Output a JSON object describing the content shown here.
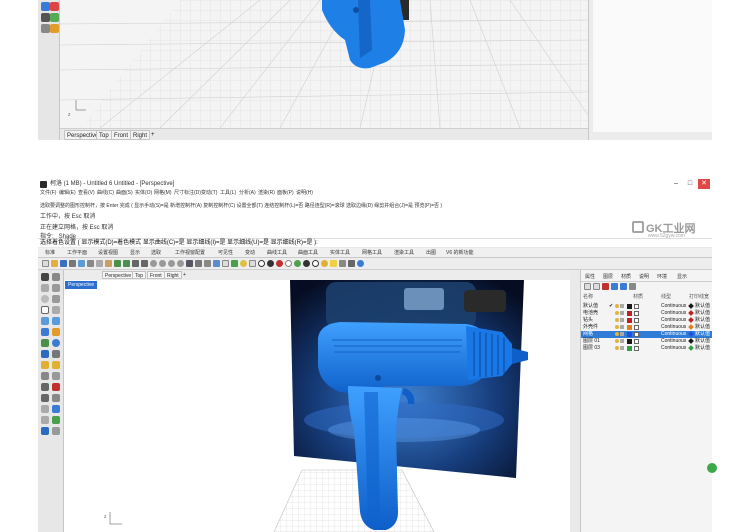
{
  "top_frame": {
    "view_tabs": [
      "Perspective",
      "Top",
      "Front",
      "Right"
    ],
    "add_tab_symbol": "+"
  },
  "app": {
    "title": "柯洛 (1 MB) - Untitled 6 Untitled - [Perspective]",
    "window_controls": {
      "minimize": "–",
      "maximize": "□",
      "close": "✕"
    },
    "menu": [
      "文件(F)",
      "编辑(E)",
      "查看(V)",
      "曲线(C)",
      "曲面(S)",
      "实体(O)",
      "网格(M)",
      "尺寸标注(D)",
      "变动(T)",
      "工具(L)",
      "分析(A)",
      "渲染(R)",
      "面板(P)",
      "说明(H)"
    ],
    "command_history": [
      "选取要调整的图形控制杆，按 Enter 完成 ( 显示手动(S)=是  新增控制杆(A)  复制控制杆(C)  设置全部(T)  连结控制杆(L)=否  路径连型(R)=滚球  选取边缘(D)  缘剪并组合(J)=是  预览(P)=否 )",
      "工作中，按 Esc 取消",
      "正在建立网格，按 Esc 取消",
      "指令: _Shade"
    ],
    "command_prompt": "选择着色设置 ( 显示模式(D)=着色模式  显示曲线(C)=是  显示细线(I)=是  显示细线(U)=是  显示细线(R)=是 ):",
    "brand": {
      "name": "GK工业网",
      "url": "www.52gyw.com"
    },
    "toolbar_tabs": [
      "标准",
      "工作平面",
      "设置视图",
      "显示",
      "选取",
      "工作视窗配置",
      "可见性",
      "变动",
      "曲线工具",
      "曲面工具",
      "实体工具",
      "网格工具",
      "渲染工具",
      "出图",
      "V6 的新功能"
    ],
    "viewport_tabs": [
      "Perspective",
      "Top",
      "Front",
      "Right"
    ],
    "add_tab_symbol": "+",
    "active_viewport": "Perspective",
    "panel": {
      "tabs": [
        "属性",
        "图层",
        "材质",
        "说明",
        "环境",
        "显示"
      ],
      "columns": [
        "名称",
        "材质",
        "线型",
        "打印线宽"
      ],
      "layers": [
        {
          "name": "默认值",
          "color": "#1a1a1a",
          "linetype": "Continuous",
          "print_width": "默认值",
          "selected": false,
          "current": true
        },
        {
          "name": "电池壳",
          "color": "#c02020",
          "linetype": "Continuous",
          "print_width": "默认值",
          "selected": false,
          "current": false
        },
        {
          "name": "钻头",
          "color": "#c02020",
          "linetype": "Continuous",
          "print_width": "默认值",
          "selected": false,
          "current": false
        },
        {
          "name": "外壳件",
          "color": "#e08020",
          "linetype": "Continuous",
          "print_width": "默认值",
          "selected": false,
          "current": false
        },
        {
          "name": "网格",
          "color": "#2050e0",
          "linetype": "Continuous",
          "print_width": "默认值",
          "selected": true,
          "current": false
        },
        {
          "name": "图层 01",
          "color": "#1a1a1a",
          "linetype": "Continuous",
          "print_width": "默认值",
          "selected": false,
          "current": false
        },
        {
          "name": "图层 03",
          "color": "#30a040",
          "linetype": "Continuous",
          "print_width": "默认值",
          "selected": false,
          "current": false
        }
      ]
    }
  },
  "colors": {
    "model_blue": "#1e7fe6",
    "selected_row": "#2f7bd6",
    "viewport_label": "#2c6fd0"
  }
}
